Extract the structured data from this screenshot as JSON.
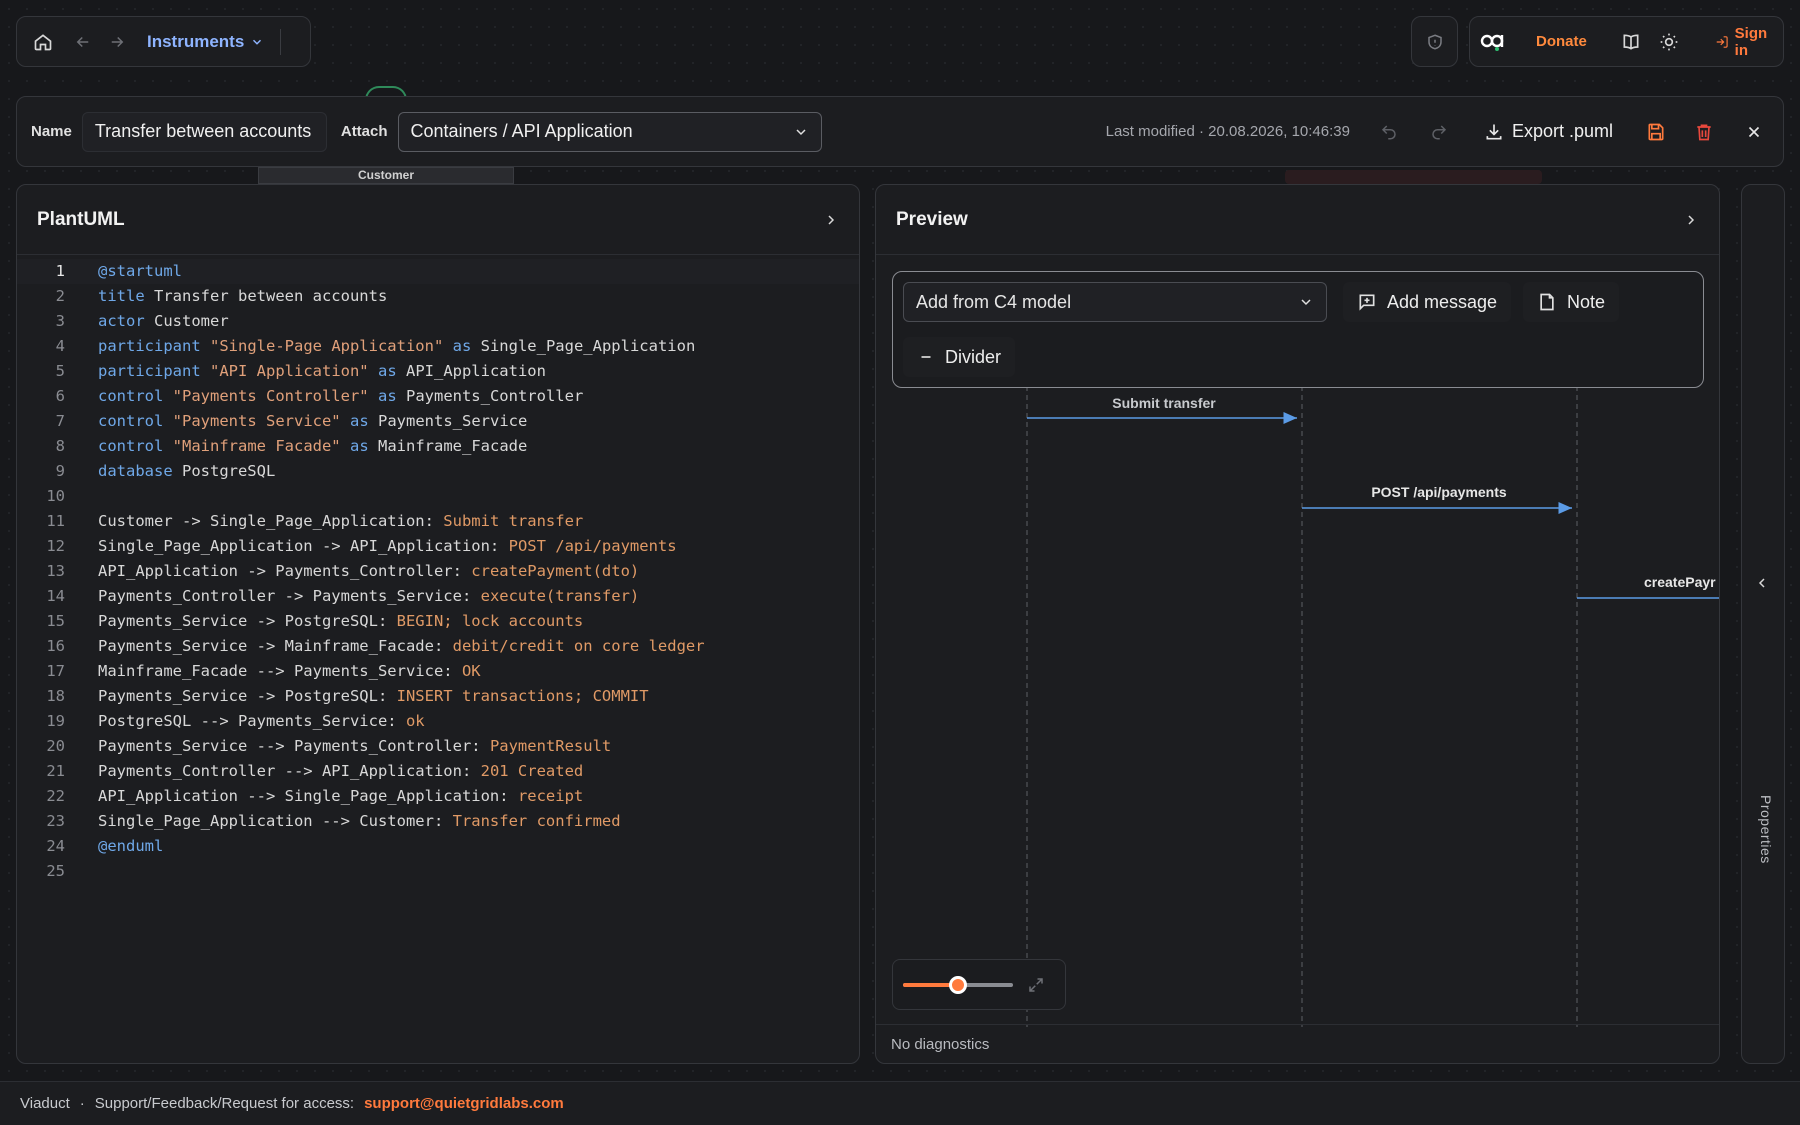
{
  "topnav": {
    "instruments_label": "Instruments"
  },
  "header": {
    "donate_label": "Donate",
    "signin_label": "Sign in"
  },
  "toolbar": {
    "name_label": "Name",
    "name_value": "Transfer between accounts",
    "attach_label": "Attach",
    "attach_value": "Containers / API Application",
    "last_modified": "Last modified · 20.08.2026, 10:46:39",
    "export_label": "Export .puml"
  },
  "background": {
    "customer_label": "Customer"
  },
  "editor": {
    "title": "PlantUML",
    "lines": [
      {
        "n": "1",
        "segs": [
          [
            "kw",
            "@startuml"
          ]
        ]
      },
      {
        "n": "2",
        "segs": [
          [
            "kw",
            "title"
          ],
          [
            "",
            " Transfer between accounts"
          ]
        ]
      },
      {
        "n": "3",
        "segs": [
          [
            "kw",
            "actor"
          ],
          [
            "",
            " Customer"
          ]
        ]
      },
      {
        "n": "4",
        "segs": [
          [
            "kw",
            "participant"
          ],
          [
            "",
            " "
          ],
          [
            "str",
            "\"Single-Page Application\""
          ],
          [
            "",
            " "
          ],
          [
            "kw",
            "as"
          ],
          [
            "",
            " Single_Page_Application"
          ]
        ]
      },
      {
        "n": "5",
        "segs": [
          [
            "kw",
            "participant"
          ],
          [
            "",
            " "
          ],
          [
            "str",
            "\"API Application\""
          ],
          [
            "",
            " "
          ],
          [
            "kw",
            "as"
          ],
          [
            "",
            " API_Application"
          ]
        ]
      },
      {
        "n": "6",
        "segs": [
          [
            "kw",
            "control"
          ],
          [
            "",
            " "
          ],
          [
            "str",
            "\"Payments Controller\""
          ],
          [
            "",
            " "
          ],
          [
            "kw",
            "as"
          ],
          [
            "",
            " Payments_Controller"
          ]
        ]
      },
      {
        "n": "7",
        "segs": [
          [
            "kw",
            "control"
          ],
          [
            "",
            " "
          ],
          [
            "str",
            "\"Payments Service\""
          ],
          [
            "",
            " "
          ],
          [
            "kw",
            "as"
          ],
          [
            "",
            " Payments_Service"
          ]
        ]
      },
      {
        "n": "8",
        "segs": [
          [
            "kw",
            "control"
          ],
          [
            "",
            " "
          ],
          [
            "str",
            "\"Mainframe Facade\""
          ],
          [
            "",
            " "
          ],
          [
            "kw",
            "as"
          ],
          [
            "",
            " Mainframe_Facade"
          ]
        ]
      },
      {
        "n": "9",
        "segs": [
          [
            "kw",
            "database"
          ],
          [
            "",
            " PostgreSQL"
          ]
        ]
      },
      {
        "n": "10",
        "segs": []
      },
      {
        "n": "11",
        "segs": [
          [
            "",
            "Customer -> Single_Page_Application: "
          ],
          [
            "msg",
            "Submit transfer"
          ]
        ]
      },
      {
        "n": "12",
        "segs": [
          [
            "",
            "Single_Page_Application -> API_Application: "
          ],
          [
            "msg",
            "POST /api/payments"
          ]
        ]
      },
      {
        "n": "13",
        "segs": [
          [
            "",
            "API_Application -> Payments_Controller: "
          ],
          [
            "msg",
            "createPayment(dto)"
          ]
        ]
      },
      {
        "n": "14",
        "segs": [
          [
            "",
            "Payments_Controller -> Payments_Service: "
          ],
          [
            "msg",
            "execute(transfer)"
          ]
        ]
      },
      {
        "n": "15",
        "segs": [
          [
            "",
            "Payments_Service -> PostgreSQL: "
          ],
          [
            "msg",
            "BEGIN; lock accounts"
          ]
        ]
      },
      {
        "n": "16",
        "segs": [
          [
            "",
            "Payments_Service -> Mainframe_Facade: "
          ],
          [
            "msg",
            "debit/credit on core ledger"
          ]
        ]
      },
      {
        "n": "17",
        "segs": [
          [
            "",
            "Mainframe_Facade --> Payments_Service: "
          ],
          [
            "msg",
            "OK"
          ]
        ]
      },
      {
        "n": "18",
        "segs": [
          [
            "",
            "Payments_Service -> PostgreSQL: "
          ],
          [
            "msg",
            "INSERT transactions; COMMIT"
          ]
        ]
      },
      {
        "n": "19",
        "segs": [
          [
            "",
            "PostgreSQL --> Payments_Service: "
          ],
          [
            "msg",
            "ok"
          ]
        ]
      },
      {
        "n": "20",
        "segs": [
          [
            "",
            "Payments_Service --> Payments_Controller: "
          ],
          [
            "msg",
            "PaymentResult"
          ]
        ]
      },
      {
        "n": "21",
        "segs": [
          [
            "",
            "Payments_Controller --> API_Application: "
          ],
          [
            "msg",
            "201 Created"
          ]
        ]
      },
      {
        "n": "22",
        "segs": [
          [
            "",
            "API_Application --> Single_Page_Application: "
          ],
          [
            "msg",
            "receipt"
          ]
        ]
      },
      {
        "n": "23",
        "segs": [
          [
            "",
            "Single_Page_Application --> Customer: "
          ],
          [
            "msg",
            "Transfer confirmed"
          ]
        ]
      },
      {
        "n": "24",
        "segs": [
          [
            "kw",
            "@enduml"
          ]
        ]
      },
      {
        "n": "25",
        "segs": []
      }
    ]
  },
  "preview": {
    "title": "Preview",
    "add_from_c4": "Add from C4 model",
    "add_message": "Add message",
    "note": "Note",
    "divider": "Divider",
    "messages": [
      "Submit transfer",
      "POST /api/payments",
      "createPayr"
    ],
    "diagnostics": "No diagnostics",
    "zoom_fraction": 0.5
  },
  "properties": {
    "label": "Properties"
  },
  "footer": {
    "brand": "Viaduct",
    "dot": "·",
    "support_text": "Support/Feedback/Request for access:",
    "email": "support@quietgridlabs.com"
  },
  "colors": {
    "accent": "#ff7a3d",
    "link": "#8eb4ff",
    "arrow": "#5b9be6"
  }
}
